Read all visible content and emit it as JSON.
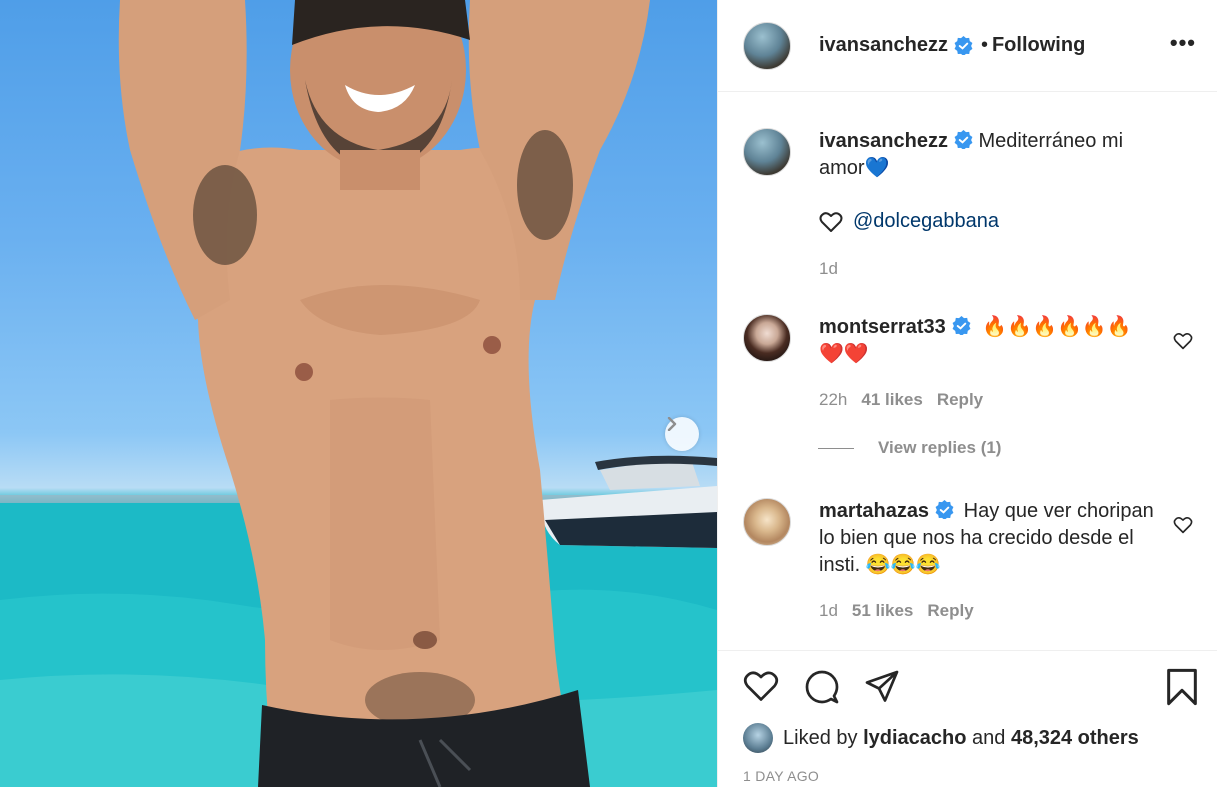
{
  "post": {
    "author": "ivansanchezz",
    "follow_status": "Following",
    "caption_text": "Mediterráneo mi amor",
    "caption_emoji": "💙",
    "mention": "@dolcegabbana",
    "caption_time": "1d",
    "liked_by_prefix": "Liked by",
    "liked_by_user": "lydiacacho",
    "liked_by_and": "and",
    "liked_by_others": "48,324 others",
    "posted_ago": "1 DAY AGO"
  },
  "comments": [
    {
      "user": "montserrat33",
      "text_line1": "🔥🔥🔥🔥🔥🔥",
      "text_line2": "❤️❤️",
      "time": "22h",
      "likes": "41 likes",
      "reply": "Reply",
      "view_replies": "View replies (1)"
    },
    {
      "user": "martahazas",
      "text": "Hay que ver choripan lo bien que nos ha crecido desde el insti. 😂😂😂",
      "time": "1d",
      "likes": "51 likes",
      "reply": "Reply"
    }
  ],
  "icons": {
    "more": "more-options-icon",
    "like": "heart-icon",
    "comment": "comment-icon",
    "share": "paper-plane-icon",
    "save": "bookmark-icon",
    "next": "chevron-right-icon",
    "verified": "verified-badge-icon"
  },
  "colors": {
    "verified": "#3897f0",
    "link": "#00376b",
    "muted": "#8e8e8e",
    "text": "#262626"
  }
}
